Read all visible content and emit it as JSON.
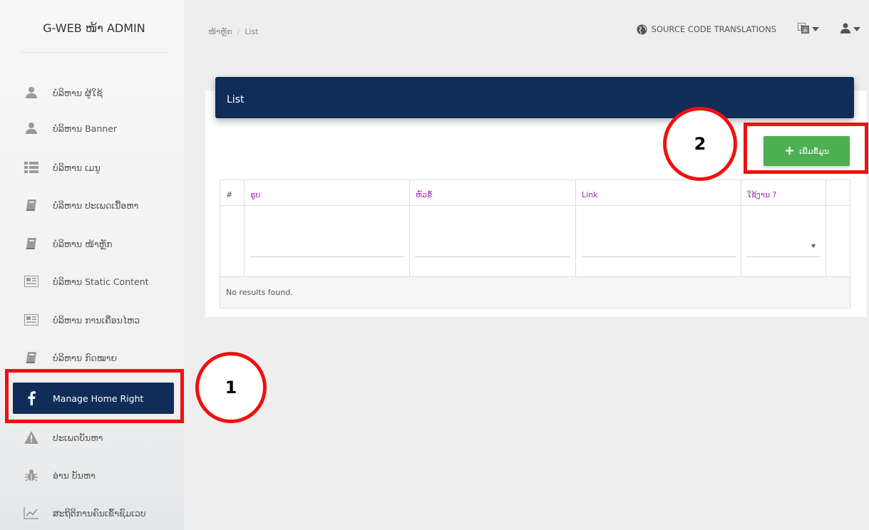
{
  "app": {
    "title": "G-WEB ໜ້າ ADMIN"
  },
  "sidebar": {
    "items": [
      {
        "label": "ບໍລິຫານ ຜູ້ໃຊ້",
        "icon": "user-icon"
      },
      {
        "label": "ບໍລິຫານ Banner",
        "icon": "user-icon"
      },
      {
        "label": "ບໍລິຫານ ເມນູ",
        "icon": "list-icon"
      },
      {
        "label": "ບໍລິຫານ ປະເພດເນື້ອຫາ",
        "icon": "book-icon"
      },
      {
        "label": "ບໍລິຫານ ໜ້າຫຼັກ",
        "icon": "book-icon"
      },
      {
        "label": "ບໍລິຫານ Static Content",
        "icon": "newspaper-icon"
      },
      {
        "label": "ບໍລິຫານ ການເຄື່ອນໄຫວ",
        "icon": "newspaper-icon"
      },
      {
        "label": "ບໍລິຫານ ກົດໝາຍ",
        "icon": "book-icon"
      },
      {
        "label": "Manage Home Right",
        "icon": "facebook-icon",
        "active": true
      },
      {
        "label": "ປະເພດບັນຫາ",
        "icon": "warning-icon"
      },
      {
        "label": "ອ່ານ ບັນຫາ",
        "icon": "bug-icon"
      },
      {
        "label": "ສະຖິຕິການຄົນເຂົ້າຊົມເວບ",
        "icon": "chart-line-icon"
      }
    ]
  },
  "breadcrumb": {
    "home": "ໜ້າຫຼັກ",
    "separator": "/",
    "current": "List"
  },
  "topnav": {
    "translations": "SOURCE CODE TRANSLATIONS"
  },
  "panel": {
    "title": "List",
    "add_button": "ເພີ່ມຂໍ້ມູນ"
  },
  "table": {
    "columns": [
      "#",
      "ຮູບ",
      "ຫົວຂໍ້",
      "Link",
      "ໃຊ້ງານ ?"
    ],
    "empty_message": "No results found."
  },
  "annotations": {
    "marker1": "1",
    "marker2": "2"
  },
  "colors": {
    "header": "#0f2d58",
    "add_button": "#4caf50",
    "column_header_text": "#9c27b0",
    "callout": "#ee1111"
  }
}
